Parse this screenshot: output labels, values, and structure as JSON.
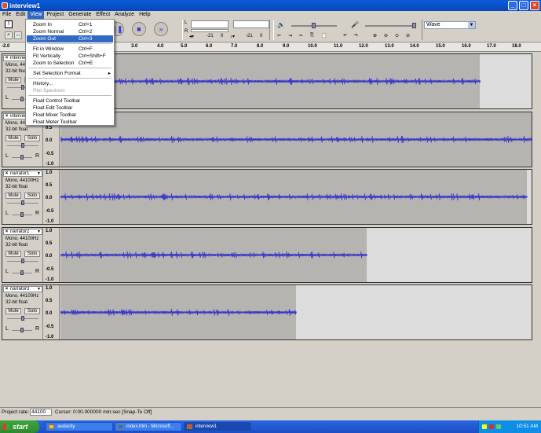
{
  "window": {
    "title": "interview1"
  },
  "menu": [
    "File",
    "Edit",
    "View",
    "Project",
    "Generate",
    "Effect",
    "Analyze",
    "Help"
  ],
  "view_menu": [
    {
      "label": "Zoom In",
      "shortcut": "Ctrl+1",
      "state": "normal"
    },
    {
      "label": "Zoom Normal",
      "shortcut": "Ctrl+2",
      "state": "normal"
    },
    {
      "label": "Zoom Out",
      "shortcut": "Ctrl+3",
      "state": "highlighted"
    },
    {
      "label": "Fit in Window",
      "shortcut": "Ctrl+F",
      "state": "normal"
    },
    {
      "label": "Fit Vertically",
      "shortcut": "Ctrl+Shift+F",
      "state": "normal"
    },
    {
      "label": "Zoom to Selection",
      "shortcut": "Ctrl+E",
      "state": "normal"
    },
    {
      "label": "Set Selection Format",
      "shortcut": "",
      "state": "submenu"
    },
    {
      "label": "History...",
      "shortcut": "",
      "state": "normal"
    },
    {
      "label": "Plot Spectrum",
      "shortcut": "",
      "state": "disabled"
    },
    {
      "label": "Float Control Toolbar",
      "shortcut": "",
      "state": "normal"
    },
    {
      "label": "Float Edit Toolbar",
      "shortcut": "",
      "state": "normal"
    },
    {
      "label": "Float Mixer Toolbar",
      "shortcut": "",
      "state": "normal"
    },
    {
      "label": "Float Meter Toolbar",
      "shortcut": "",
      "state": "normal"
    }
  ],
  "meters": {
    "L": "L",
    "R": "R",
    "db_left": "-21",
    "zero_left": "0",
    "db_right": "-21",
    "zero_right": "0"
  },
  "wave_select": "Wave",
  "ruler": [
    "-2.0",
    "3.0",
    "4.0",
    "5.0",
    "6.0",
    "7.0",
    "8.0",
    "9.0",
    "10.0",
    "11.0",
    "12.0",
    "13.0",
    "14.0",
    "15.0",
    "16.0",
    "17.0",
    "18.0",
    "19.0"
  ],
  "tracks": [
    {
      "name": "interview",
      "info1": "Mono, 44100Hz",
      "info2": "32-bit float",
      "mute": "Mute",
      "solo": "Solo",
      "L": "L",
      "R": "R",
      "ticks": [
        "1.0",
        "0.5",
        "0.0",
        "-0.5",
        "-1.0"
      ],
      "audio_end_fraction": 0.89
    },
    {
      "name": "interview",
      "info1": "Mono, 44100Hz",
      "info2": "32-bit float",
      "mute": "Mute",
      "solo": "Solo",
      "L": "L",
      "R": "R",
      "ticks": [
        "1.0",
        "0.5",
        "0.0",
        "-0.5",
        "-1.0"
      ],
      "audio_end_fraction": 1.0
    },
    {
      "name": "narrator1",
      "info1": "Mono, 44100Hz",
      "info2": "32-bit float",
      "mute": "Mute",
      "solo": "Solo",
      "L": "L",
      "R": "R",
      "ticks": [
        "1.0",
        "0.5",
        "0.0",
        "-0.5",
        "-1.0"
      ],
      "audio_end_fraction": 0.99
    },
    {
      "name": "narrator2",
      "info1": "Mono, 44100Hz",
      "info2": "32-bit float",
      "mute": "Mute",
      "solo": "Solo",
      "L": "L",
      "R": "R",
      "ticks": [
        "1.0",
        "0.5",
        "0.0",
        "-0.5",
        "-1.0"
      ],
      "audio_end_fraction": 0.65
    },
    {
      "name": "narrator3",
      "info1": "Mono, 44100Hz",
      "info2": "32-bit float",
      "mute": "Mute",
      "solo": "Solo",
      "L": "L",
      "R": "R",
      "ticks": [
        "1.0",
        "0.5",
        "0.0",
        "-0.5",
        "-1.0"
      ],
      "audio_end_fraction": 0.5
    }
  ],
  "status": {
    "rate_label": "Project rate:",
    "rate": "44100",
    "cursor": "Cursor: 0:00.000000 min:sec  [Snap-To Off]"
  },
  "taskbar": {
    "start": "start",
    "items": [
      "audacity",
      "index.htm - Microsoft...",
      "interview1"
    ],
    "clock": "10:51 AM"
  },
  "colors": {
    "wave": "#3a3ac8",
    "selection": "#316ac5",
    "titlebar": "#0a5ad8"
  }
}
